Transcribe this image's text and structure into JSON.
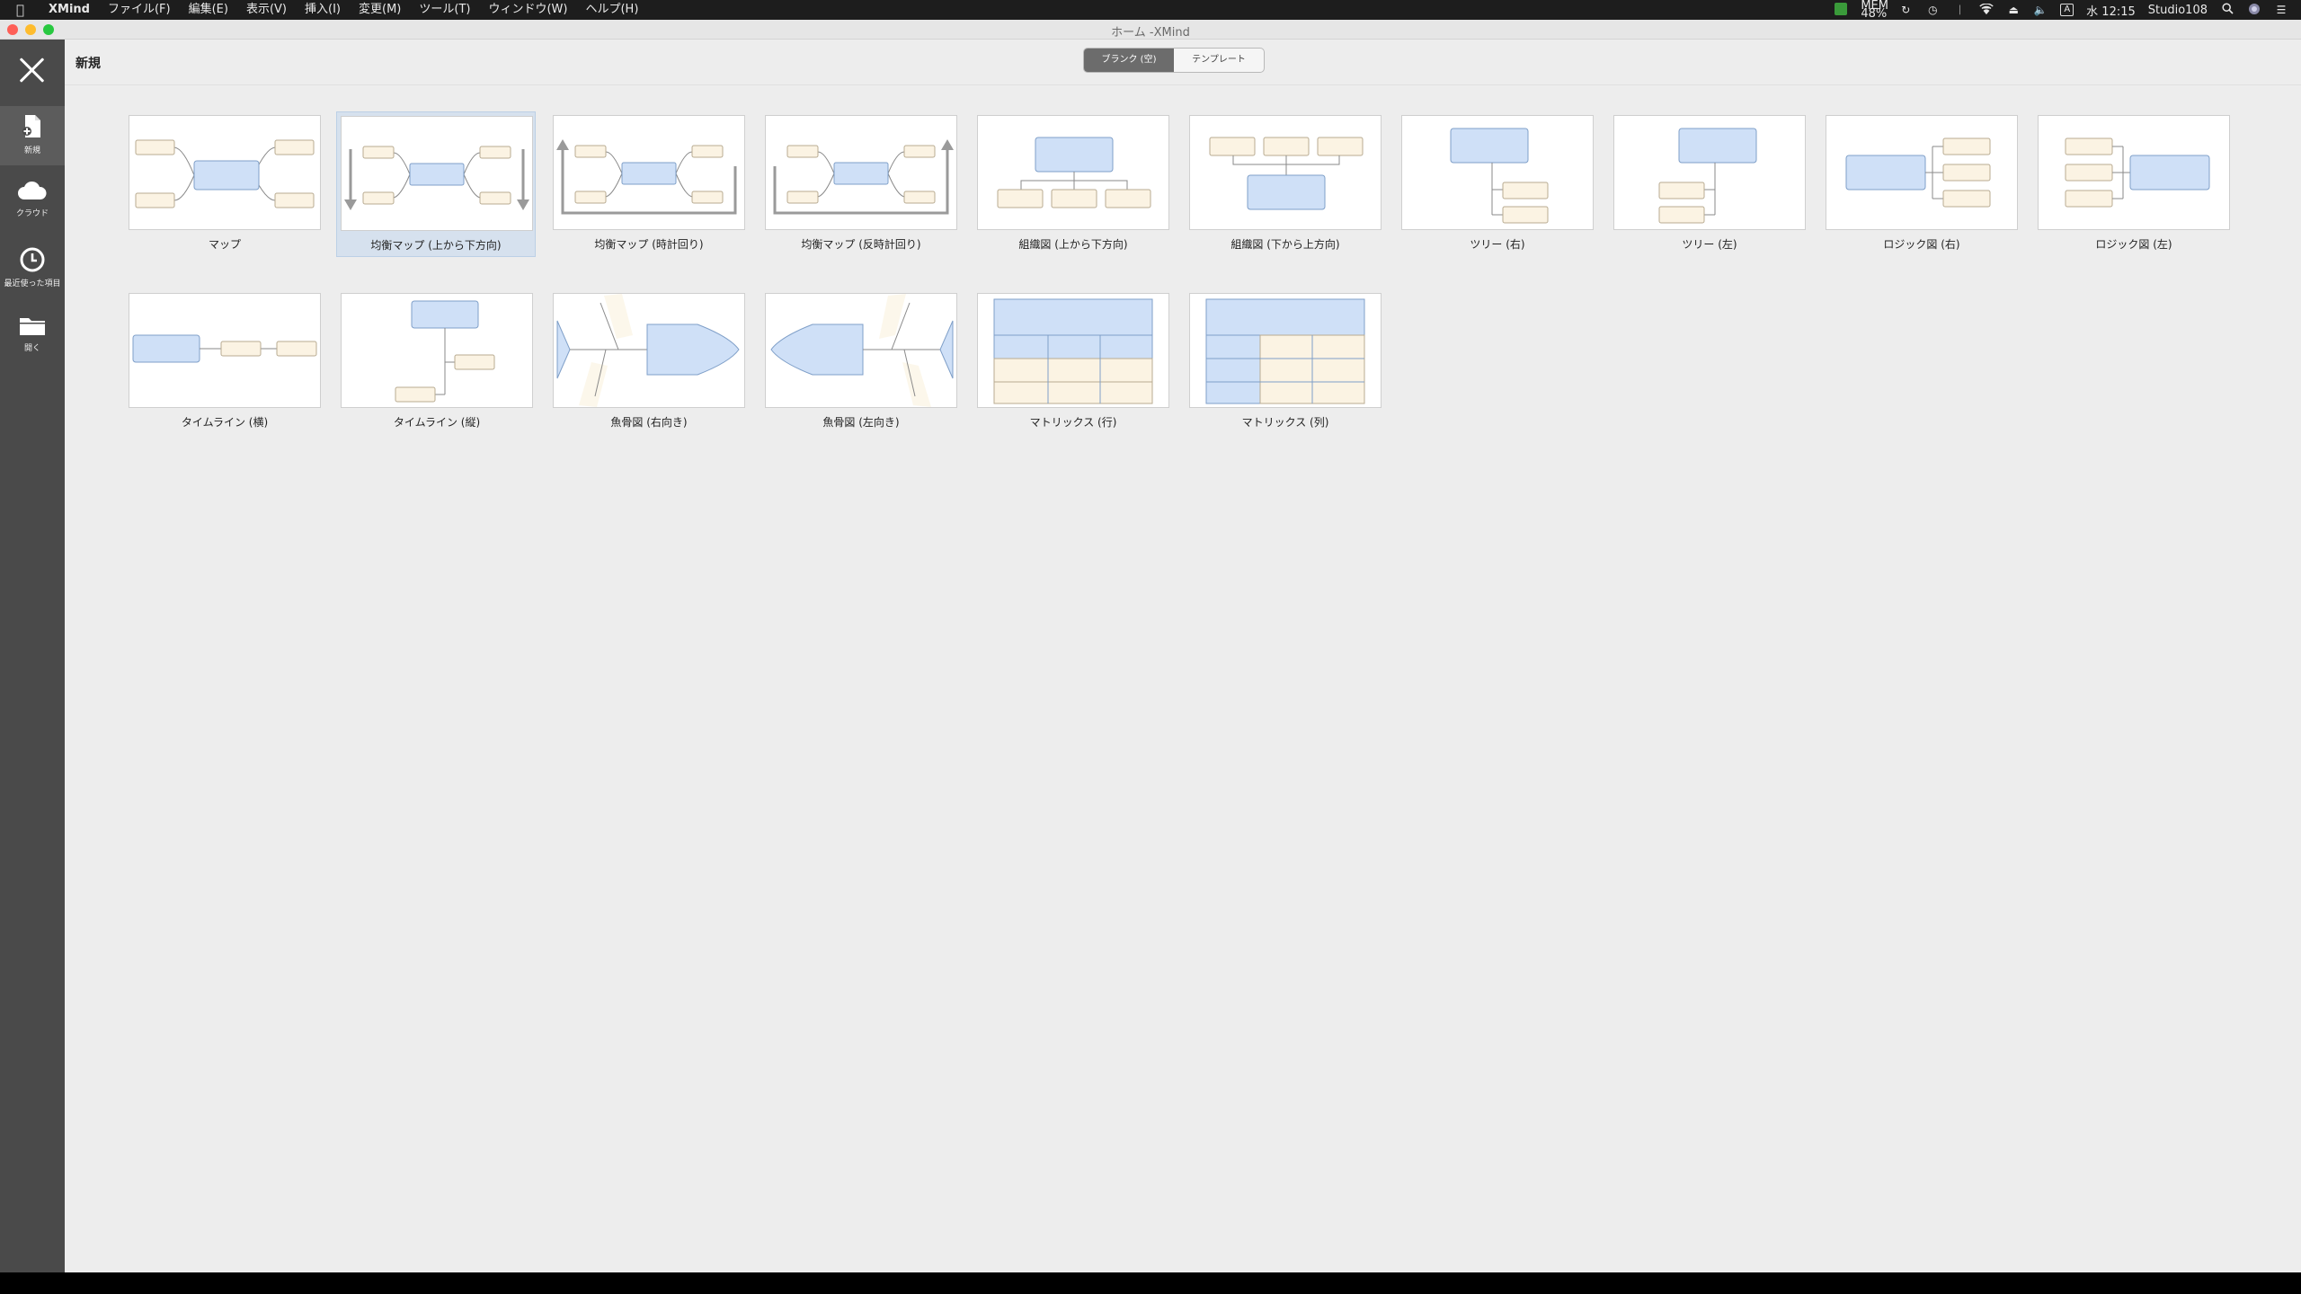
{
  "menubar": {
    "app_name": "XMind",
    "items": [
      "ファイル(F)",
      "編集(E)",
      "表示(V)",
      "挿入(I)",
      "変更(M)",
      "ツール(T)",
      "ウィンドウ(W)",
      "ヘルプ(H)"
    ],
    "status": {
      "mem_label": "MEM",
      "mem_value": "48%",
      "clock": "水 12:15",
      "user": "Studio108",
      "input_indicator": "A"
    }
  },
  "window": {
    "title": "ホーム -XMind"
  },
  "sidebar": {
    "items": [
      {
        "label": "新規",
        "icon": "new-file-icon"
      },
      {
        "label": "クラウド",
        "icon": "cloud-icon"
      },
      {
        "label": "最近使った項目",
        "icon": "clock-icon"
      },
      {
        "label": "開く",
        "icon": "folder-icon"
      }
    ]
  },
  "main": {
    "title": "新規",
    "tabs": [
      {
        "label": "ブランク (空)",
        "active": true
      },
      {
        "label": "テンプレート",
        "active": false
      }
    ],
    "templates_row1": [
      {
        "name": "マップ"
      },
      {
        "name": "均衡マップ (上から下方向)"
      },
      {
        "name": "均衡マップ (時計回り)"
      },
      {
        "name": "均衡マップ (反時計回り)"
      },
      {
        "name": "組織図 (上から下方向)"
      },
      {
        "name": "組織図 (下から上方向)"
      },
      {
        "name": "ツリー (右)"
      },
      {
        "name": "ツリー (左)"
      },
      {
        "name": "ロジック図 (右)"
      },
      {
        "name": "ロジック図 (左)"
      }
    ],
    "templates_row2": [
      {
        "name": "タイムライン (横)"
      },
      {
        "name": "タイムライン (縦)"
      },
      {
        "name": "魚骨図 (右向き)"
      },
      {
        "name": "魚骨図 (左向き)"
      },
      {
        "name": "マトリックス (行)"
      },
      {
        "name": "マトリックス (列)"
      }
    ],
    "selected_template": "均衡マップ (上から下方向)"
  },
  "colors": {
    "topic_blue": "#cfe0f7",
    "topic_stroke": "#7f9fc8",
    "sub_cream": "#fbf3e3",
    "sub_stroke": "#b8ab92",
    "line": "#8a8a8a"
  }
}
